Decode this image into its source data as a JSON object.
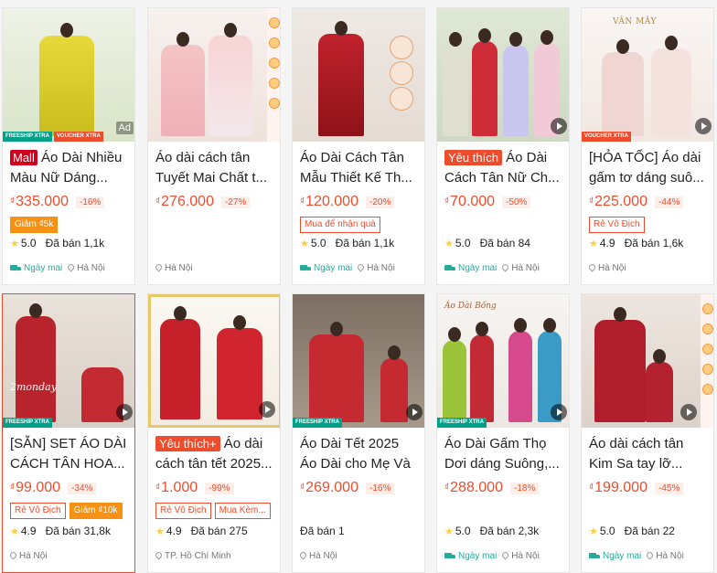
{
  "colors": {
    "brand": "#ee4d2d",
    "fast": "#26aa99",
    "mall": "#d0011b"
  },
  "badges": {
    "freeship": "FREESHIP XTRA",
    "voucher": "VOUCHER XTRA",
    "ad": "Ad"
  },
  "products": [
    {
      "tag": "Mall",
      "title": "Áo Dài Nhiều Màu Nữ Dáng...",
      "price": "335.000",
      "currency": "₫",
      "discount": "-16%",
      "promos": [
        "Giảm ₫5k"
      ],
      "rating": "5.0",
      "sold": "Đã bán 1,1k",
      "fast": "Ngày mai",
      "location": "Hà Nội"
    },
    {
      "tag": "",
      "title": "Áo dài cách tân Tuyết Mai Chất t...",
      "price": "276.000",
      "currency": "₫",
      "discount": "-27%",
      "promos": [],
      "rating": "",
      "sold": "",
      "fast": "",
      "location": "Hà Nội"
    },
    {
      "tag": "",
      "title": "Áo Dài Cách Tân Mẫu Thiết Kế Th...",
      "price": "120.000",
      "currency": "₫",
      "discount": "-20%",
      "promos": [
        "Mua để nhận quà"
      ],
      "rating": "5.0",
      "sold": "Đã bán 1,1k",
      "fast": "Ngày mai",
      "location": "Hà Nội"
    },
    {
      "tag": "Yêu thích",
      "title": "Áo Dài Cách Tân Nữ Ch...",
      "price": "70.000",
      "currency": "₫",
      "discount": "-50%",
      "promos": [],
      "rating": "5.0",
      "sold": "Đã bán 84",
      "fast": "Ngày mai",
      "location": "Hà Nội"
    },
    {
      "tag": "",
      "title": "[HỎA TỐC] Áo dài gấm tơ dáng suô...",
      "price": "225.000",
      "currency": "₫",
      "discount": "-44%",
      "promos": [
        "Rẻ Vô Địch"
      ],
      "rating": "4.9",
      "sold": "Đã bán 1,6k",
      "fast": "",
      "location": "Hà Nội"
    },
    {
      "tag": "",
      "title": "[SẴN] SET ÁO DÀI CÁCH TÂN HOA...",
      "price": "99.000",
      "currency": "₫",
      "discount": "-34%",
      "promos": [
        "Rẻ Vô Địch",
        "Giảm ₫10k"
      ],
      "rating": "4.9",
      "sold": "Đã bán 31,8k",
      "fast": "",
      "location": "Hà Nội"
    },
    {
      "tag": "Yêu thích+",
      "title": "Áo dài cách tân tết 2025...",
      "price": "1.000",
      "currency": "₫",
      "discount": "-99%",
      "promos": [
        "Rẻ Vô Địch",
        "Mua Kèm..."
      ],
      "rating": "4.9",
      "sold": "Đã bán 275",
      "fast": "",
      "location": "TP. Hồ Chí Minh"
    },
    {
      "tag": "",
      "title": "Áo Dài Tết 2025 Áo Dài cho Mẹ Và c...",
      "price": "269.000",
      "currency": "₫",
      "discount": "-16%",
      "promos": [],
      "rating": "",
      "sold": "Đã bán 1",
      "fast": "",
      "location": "Hà Nội"
    },
    {
      "tag": "",
      "title": "Áo Dài Gấm Thọ Dơi dáng Suông,...",
      "price": "288.000",
      "currency": "₫",
      "discount": "-18%",
      "promos": [],
      "rating": "5.0",
      "sold": "Đã bán 2,3k",
      "fast": "Ngày mai",
      "location": "Hà Nội"
    },
    {
      "tag": "",
      "title": "Áo dài cách tân Kim Sa tay lỡ...",
      "price": "199.000",
      "currency": "₫",
      "discount": "-45%",
      "promos": [],
      "rating": "5.0",
      "sold": "Đã bán 22",
      "fast": "Ngày mai",
      "location": "Hà Nội"
    }
  ],
  "image_text": {
    "p5_logo": "VÂN MÂY",
    "p6_overlay": "2monday",
    "p9_logo": "Áo Dài Bống"
  }
}
